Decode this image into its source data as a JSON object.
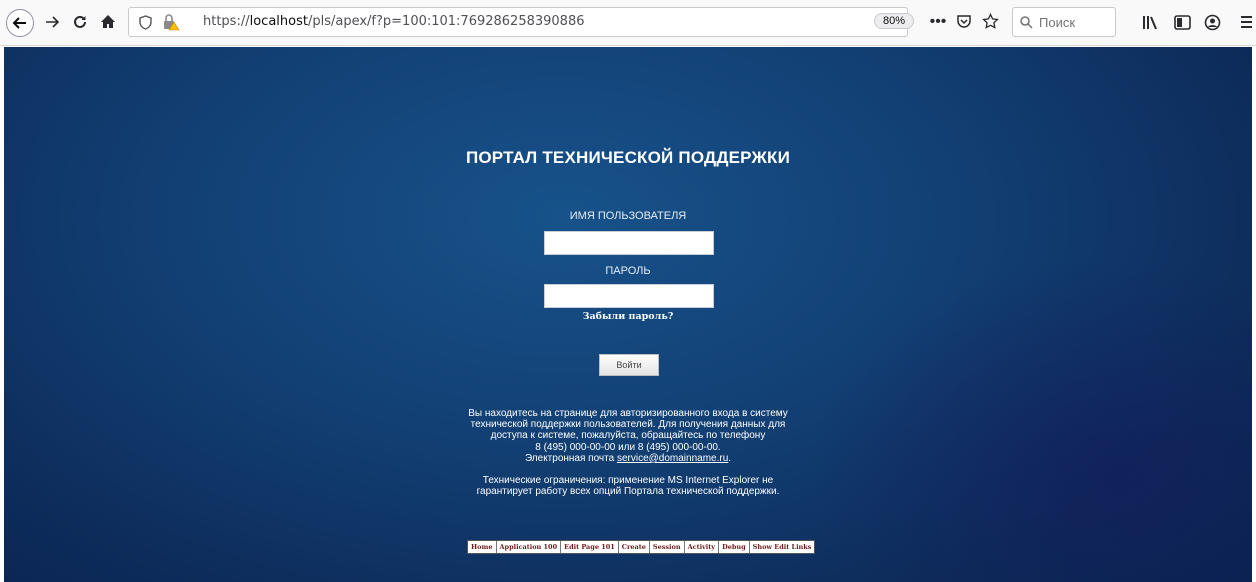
{
  "browser": {
    "url_prefix": "https://",
    "url_host": "localhost",
    "url_path": "/pls/apex/f?p=100:101:769286258390886",
    "zoom": "80%",
    "search_placeholder": "Поиск",
    "icons": [
      "back-icon",
      "forward-icon",
      "reload-icon",
      "home-icon",
      "shield-icon",
      "insecure-lock-icon",
      "page-actions-icon",
      "pocket-icon",
      "bookmark-star-icon",
      "search-icon",
      "library-icon",
      "sidebar-icon",
      "account-icon",
      "menu-icon"
    ]
  },
  "page": {
    "title": "ПОРТАЛ ТЕХНИЧЕСКОЙ ПОДДЕРЖКИ",
    "username_label": "ИМЯ ПОЛЬЗОВАТЕЛЯ",
    "username_value": "",
    "password_label": "ПАРОЛЬ",
    "password_value": "",
    "forgot_link": "Забыли пароль?",
    "login_button": "Войти",
    "info": {
      "line1": "Вы находитесь на странице для авторизированного входа в систему",
      "line2": "технической поддержки пользователей. Для получения данных для",
      "line3": "доступа к системе, пожалуйста, обращайтесь по телефону",
      "line4": "8 (495) 000-00-00 или 8 (495) 000-00-00.",
      "email_prefix": "Электронная почта ",
      "email": "service@domainname.ru",
      "email_suffix": ".",
      "restriction1": "Технические ограничения: применение MS Internet Explorer не",
      "restriction2": "гарантирует работу всех опций Портала технической поддержки."
    },
    "dev_toolbar": [
      "Home",
      "Application 100",
      "Edit Page 101",
      "Create",
      "Session",
      "Activity",
      "Debug",
      "Show Edit Links"
    ]
  }
}
